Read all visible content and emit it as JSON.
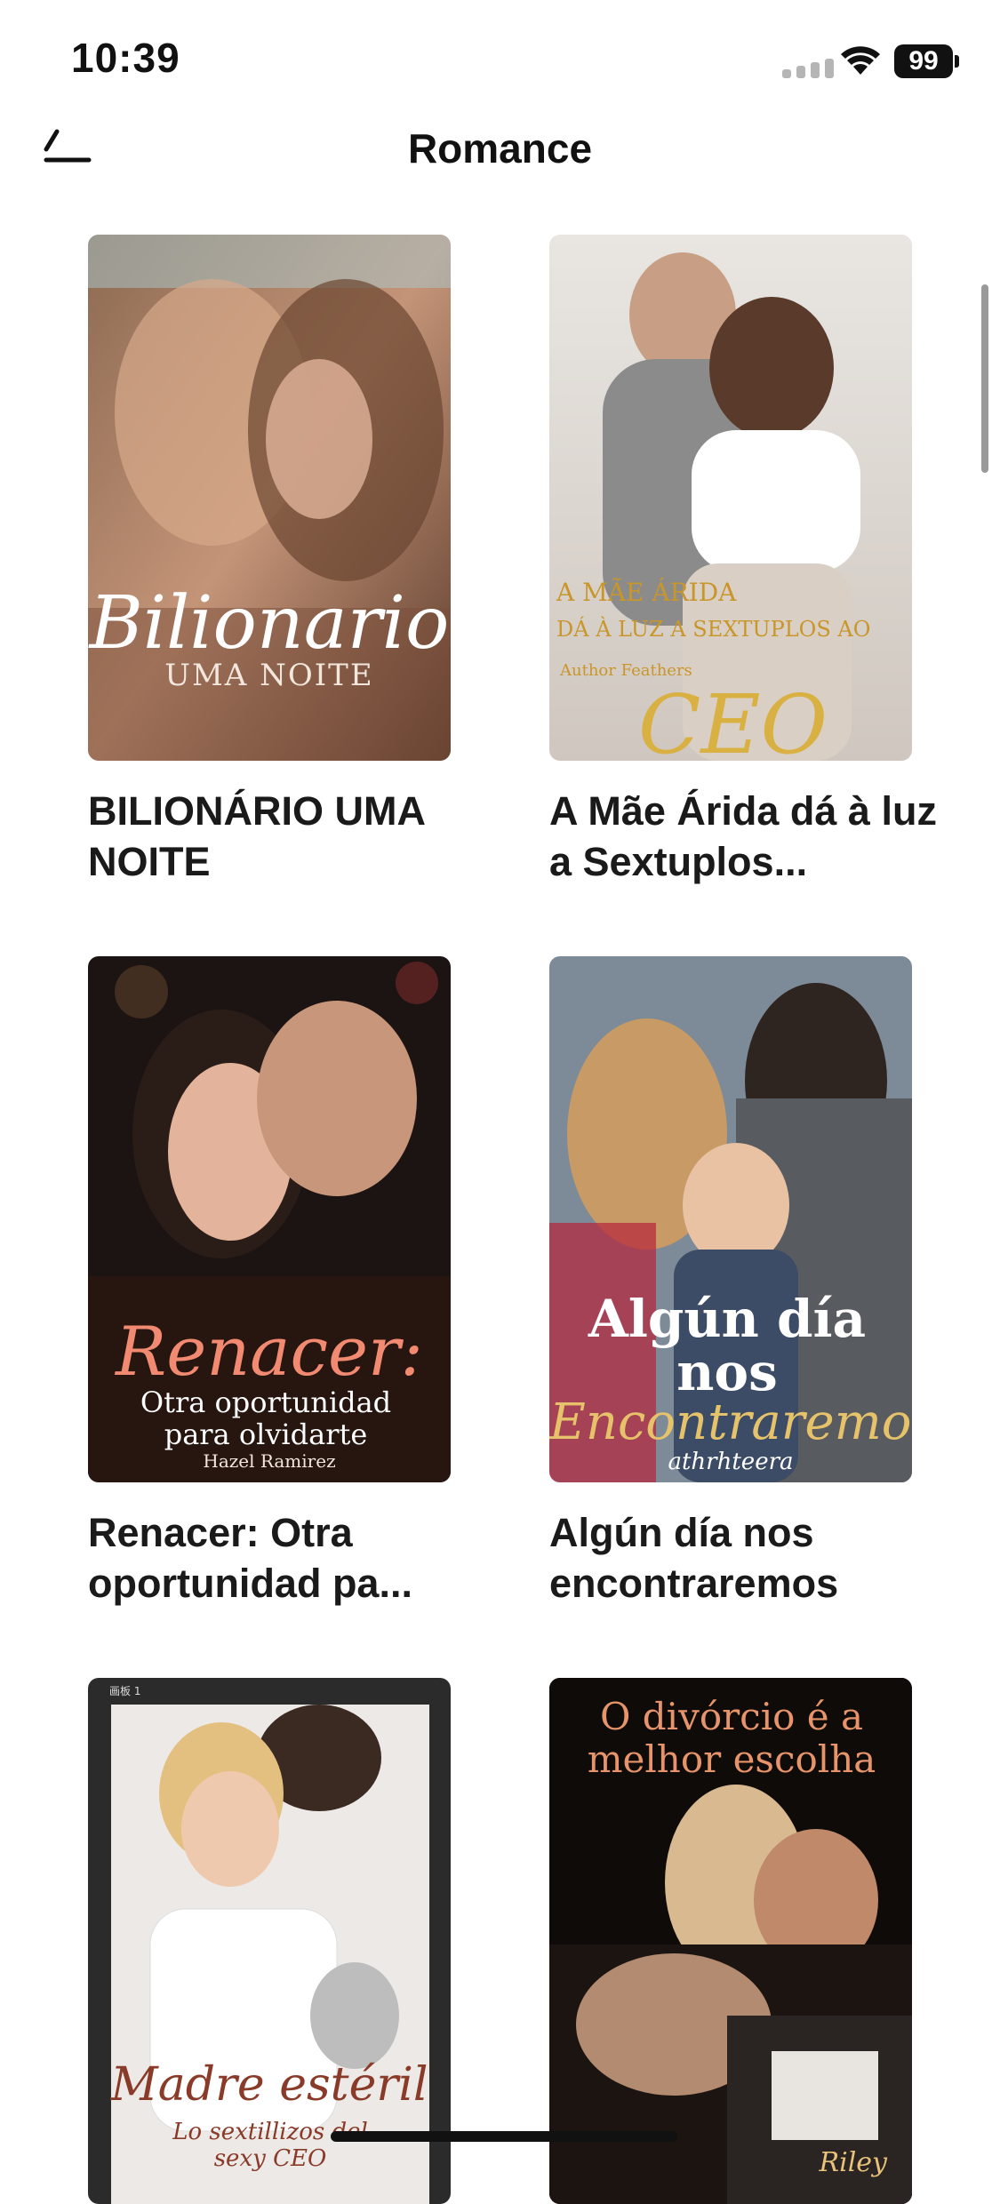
{
  "status": {
    "time": "10:39",
    "battery": "99"
  },
  "header": {
    "title": "Romance"
  },
  "books": [
    {
      "title": "BILIONÁRIO UMA NOITE",
      "cover_title": "Bilionario",
      "cover_subtitle": "UMA NOITE"
    },
    {
      "title": "A Mãe Árida dá à luz a Sextuplos...",
      "cover_title": "A MÃE ÁRIDA",
      "cover_subtitle": "DÁ À LUZ A SEXTUPLOS AO",
      "cover_author": "Author Feathers",
      "cover_ceo": "CEO"
    },
    {
      "title": "Renacer: Otra oportunidad pa...",
      "cover_title": "Renacer:",
      "cover_subtitle": "Otra oportunidad para olvidarte",
      "cover_author": "Hazel Ramirez"
    },
    {
      "title": "Algún día nos encontraremos",
      "cover_title": "Algún día nos",
      "cover_subtitle": "Encontraremos",
      "cover_author": "athrhteera"
    },
    {
      "title": "",
      "cover_title": "Madre estéril",
      "cover_subtitle": "Lo sextillizos del sexy CEO",
      "cover_label": "画板 1"
    },
    {
      "title": "",
      "cover_title": "O divórcio é a melhor escolha",
      "cover_author": "Riley"
    }
  ]
}
